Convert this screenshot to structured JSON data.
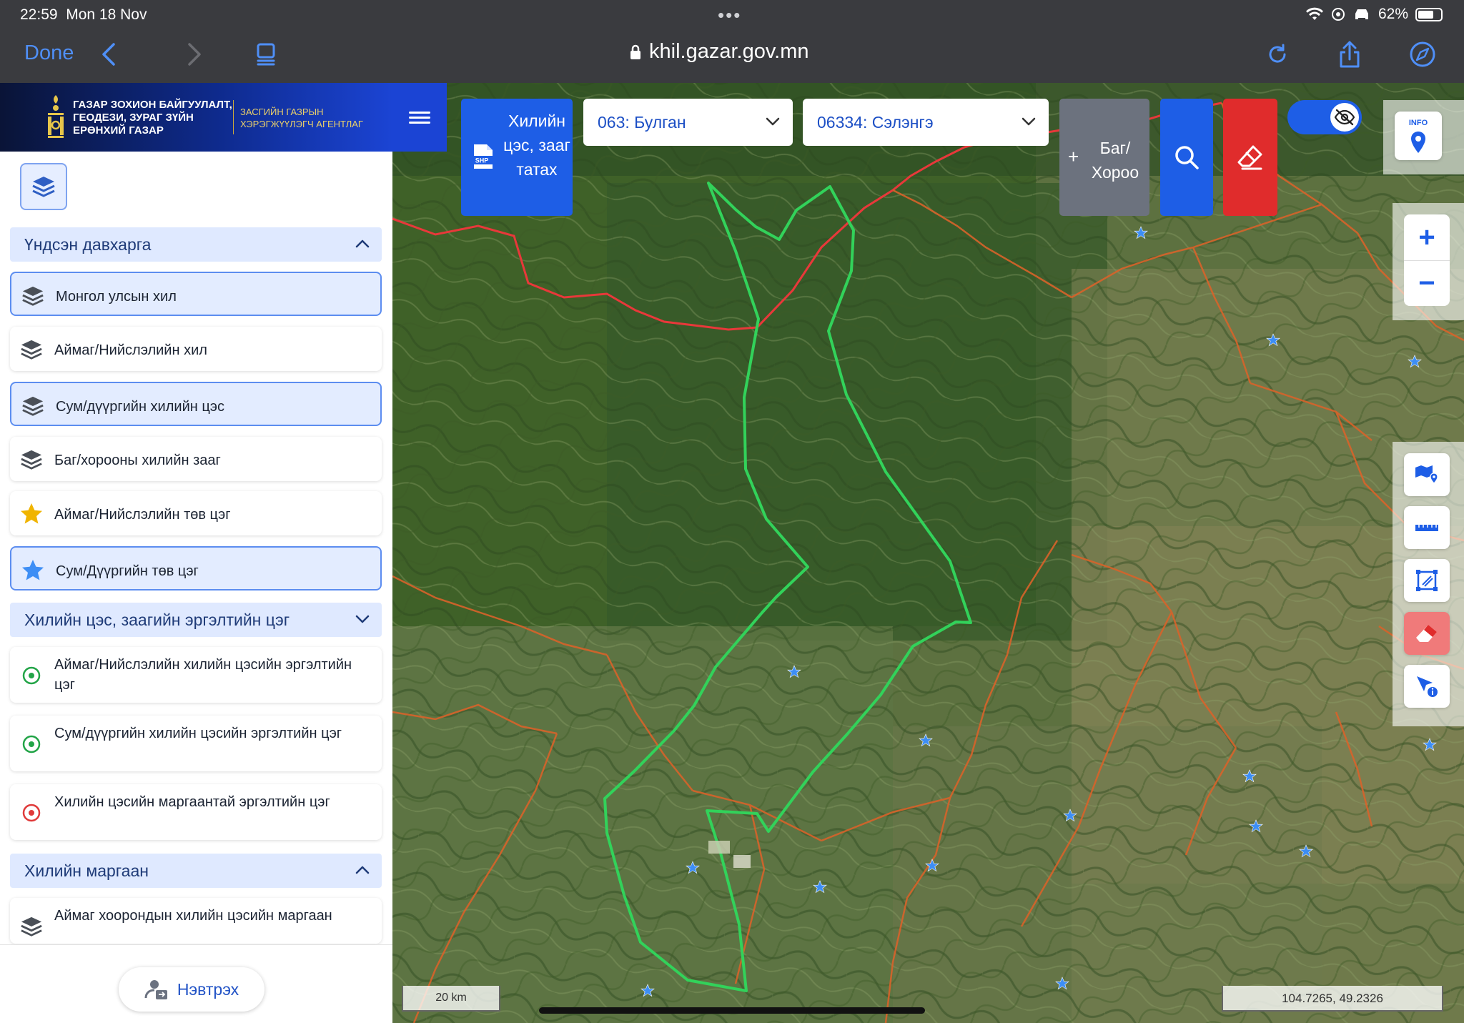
{
  "status": {
    "time": "22:59",
    "date": "Mon 18 Nov",
    "battery": "62%"
  },
  "browser": {
    "done_label": "Done",
    "url": "khil.gazar.gov.mn"
  },
  "brand": {
    "org_line1": "ГАЗАР ЗОХИОН БАЙГУУЛАЛТ,",
    "org_line2": "ГЕОДЕЗИ, ЗУРАГ ЗҮЙН",
    "org_line3": "ЕРӨНХИЙ ГАЗАР",
    "agency_line1": "ЗАСГИЙН ГАЗРЫН",
    "agency_line2": "ХЭРЭГЖҮҮЛЭГЧ АГЕНТЛАГ"
  },
  "sidebar": {
    "sections": [
      {
        "label": "Үндсэн давхарга",
        "expanded": true
      },
      {
        "label": "Хилийн цэс, заагийн эргэлтийн цэг",
        "expanded": false
      },
      {
        "label": "Хилийн маргаан",
        "expanded": true
      }
    ],
    "base_layers": [
      {
        "label": "Монгол улсын хил",
        "icon": "layers-icon",
        "active": true
      },
      {
        "label": "Аймаг/Нийслэлийн хил",
        "icon": "layers-icon",
        "active": false
      },
      {
        "label": "Сум/дүүргийн хилийн цэс",
        "icon": "layers-icon",
        "active": true
      },
      {
        "label": "Баг/хорооны хилийн зааг",
        "icon": "layers-icon",
        "active": false
      },
      {
        "label": "Аймаг/Нийслэлийн төв цэг",
        "icon": "star-icon",
        "active": false
      },
      {
        "label": "Сум/Дүүргийн төв цэг",
        "icon": "star-icon",
        "active": true
      }
    ],
    "turn_points": [
      {
        "label": "Аймаг/Нийслэлийн хилийн цэсийн эргэлтийн цэг",
        "color": "#22a447"
      },
      {
        "label": "Сум/дүүргийн хилийн цэсийн эргэлтийн цэг",
        "color": "#22a447"
      },
      {
        "label": "Хилийн цэсийн маргаантай эргэлтийн цэг",
        "color": "#e03a3a"
      }
    ],
    "disputes": [
      {
        "label": "Аймаг хоорондын хилийн цэсийн маргаан",
        "icon": "layers-icon"
      }
    ],
    "login_label": "Нэвтрэх"
  },
  "map_toolbar": {
    "shp_label": "Хилийн цэс, зааг татах",
    "shp_icon_text": "SHP",
    "aimag_select": "063: Булган",
    "sum_select": "06334: Сэлэнгэ",
    "bag_plus": "+",
    "bag_label": "Баг/ Хороо",
    "info_text": "INFO"
  },
  "zoom": {
    "in": "+",
    "out": "−"
  },
  "map_footer": {
    "scale": "20 km",
    "coords": "104.7265, 49.2326"
  },
  "colors": {
    "primary": "#1e5ee6",
    "danger": "#e02c2c",
    "selected_boundary": "#32d25a",
    "national_border": "#e8383a",
    "district_border": "#d8632a",
    "center_star": "#3d8ef5"
  }
}
